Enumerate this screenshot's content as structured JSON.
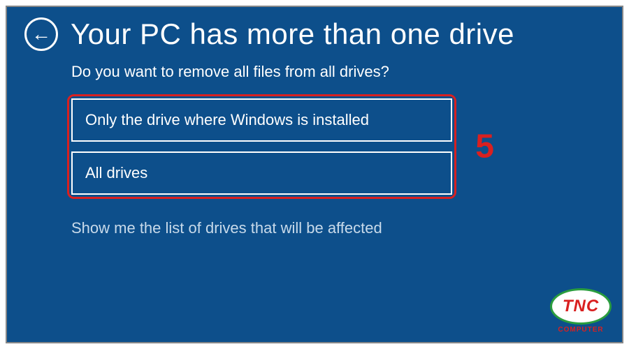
{
  "header": {
    "title": "Your PC has more than one drive"
  },
  "subtitle": "Do you want to remove all files from all drives?",
  "options": {
    "first": "Only the drive where Windows is installed",
    "second": "All drives"
  },
  "link": "Show me the list of drives that will be affected",
  "annotation": {
    "step": "5"
  },
  "watermark": {
    "brand": "TNC",
    "sub": "COMPUTER"
  }
}
